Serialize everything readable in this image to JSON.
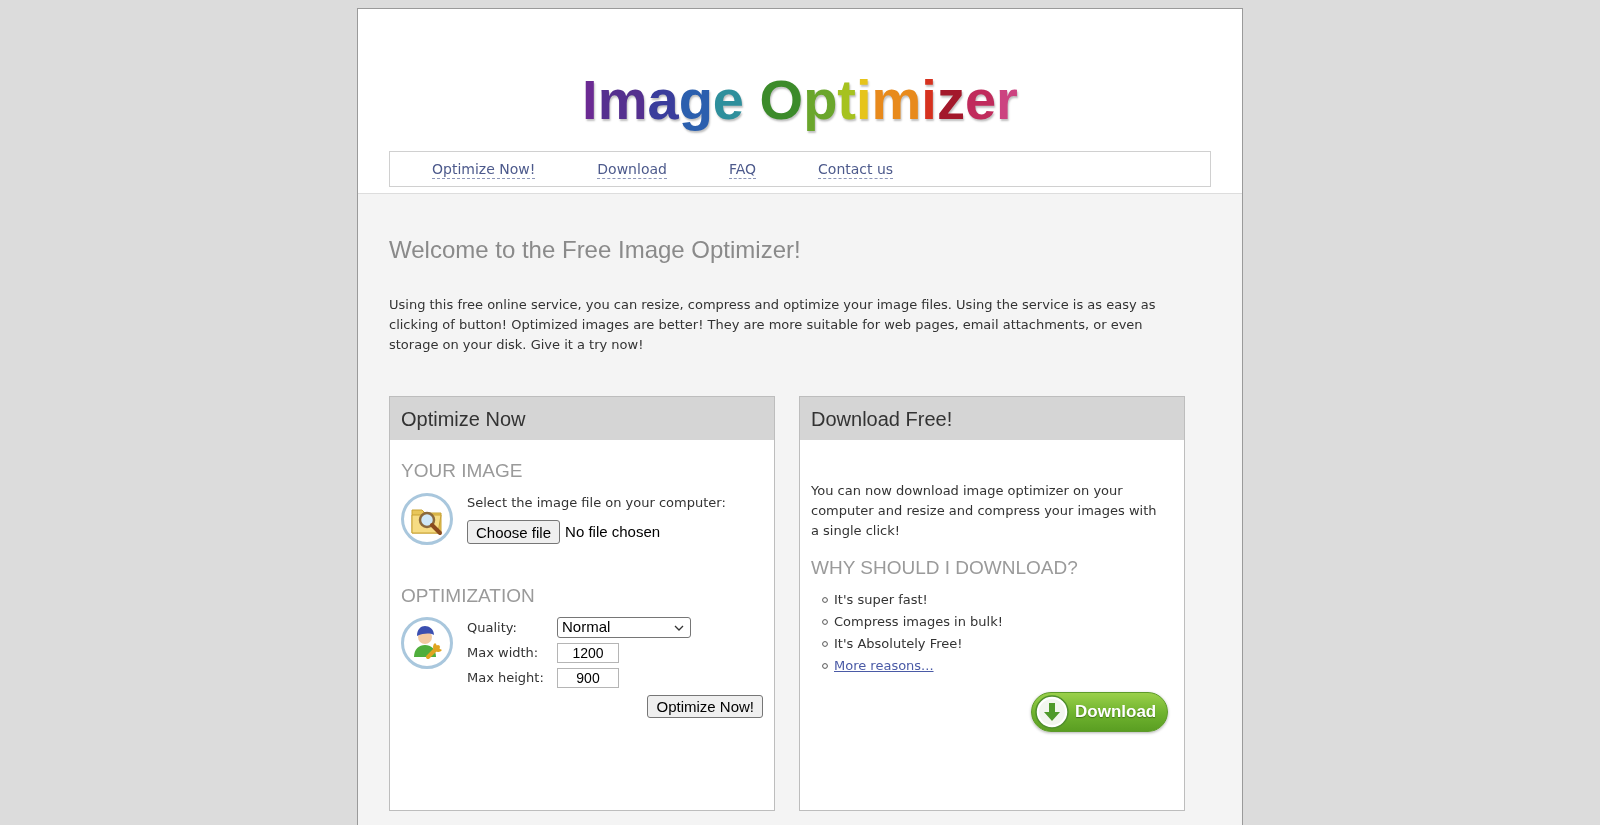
{
  "header": {
    "logo": "Image Optimizer"
  },
  "nav": [
    {
      "label": "Optimize Now!"
    },
    {
      "label": "Download"
    },
    {
      "label": "FAQ"
    },
    {
      "label": "Contact us"
    }
  ],
  "intro": {
    "title": "Welcome to the Free Image Optimizer!",
    "text": "Using this free online service, you can resize, compress and optimize your image files. Using the service is as easy as clicking of button! Optimized images are better! They are more suitable for web pages, email attachments, or even storage on your disk. Give it a try now!"
  },
  "optimize_panel": {
    "title": "Optimize Now",
    "image_section": {
      "heading": "YOUR IMAGE",
      "prompt": "Select the image file on your computer:",
      "file_button": "Choose file",
      "file_status": "No file chosen"
    },
    "optimization_section": {
      "heading": "OPTIMIZATION",
      "fields": [
        {
          "kind": "select",
          "label": "Quality:",
          "value": "Normal"
        },
        {
          "kind": "input",
          "label": "Max width:",
          "value": "1200"
        },
        {
          "kind": "input",
          "label": "Max height:",
          "value": "900"
        }
      ]
    },
    "submit_button": "Optimize Now!"
  },
  "download_panel": {
    "title": "Download Free!",
    "text": "You can now download image optimizer on your computer and resize and compress your images with a single click!",
    "reasons_heading": "WHY SHOULD I DOWNLOAD?",
    "reasons": [
      {
        "kind": "text",
        "label": "It's super fast!"
      },
      {
        "kind": "text",
        "label": "Compress images in bulk!"
      },
      {
        "kind": "text",
        "label": "It's Absolutely Free!"
      },
      {
        "kind": "link",
        "label": "More reasons..."
      }
    ],
    "download_button": "Download"
  }
}
